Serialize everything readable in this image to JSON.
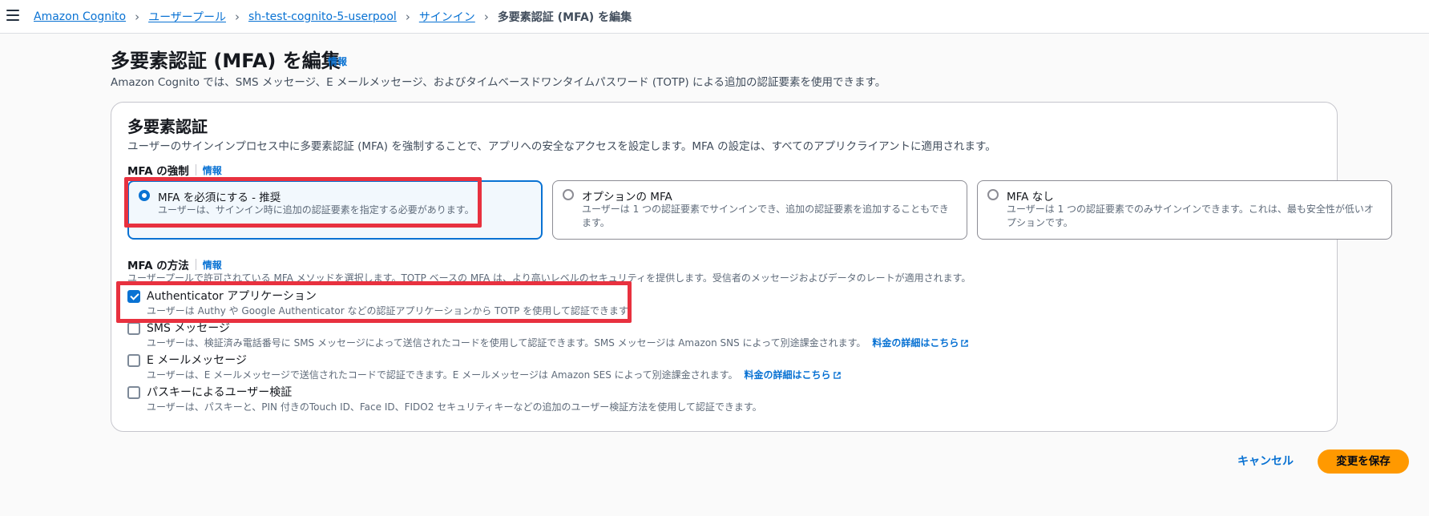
{
  "breadcrumb": {
    "items": [
      "Amazon Cognito",
      "ユーザープール",
      "sh-test-cognito-5-userpool",
      "サインイン"
    ],
    "current": "多要素認証 (MFA) を編集"
  },
  "page": {
    "title": "多要素認証 (MFA) を編集",
    "info": "情報",
    "description": "Amazon Cognito では、SMS メッセージ、E メールメッセージ、およびタイムベースドワンタイムパスワード (TOTP) による追加の認証要素を使用できます。"
  },
  "panel": {
    "title": "多要素認証",
    "description": "ユーザーのサインインプロセス中に多要素認証 (MFA) を強制することで、アプリへの安全なアクセスを設定します。MFA の設定は、すべてのアプリクライアントに適用されます。"
  },
  "enforcement": {
    "label": "MFA の強制",
    "info": "情報",
    "options": [
      {
        "title": "MFA を必須にする - 推奨",
        "desc": "ユーザーは、サインイン時に追加の認証要素を指定する必要があります。",
        "selected": true
      },
      {
        "title": "オプションの MFA",
        "desc": "ユーザーは 1 つの認証要素でサインインでき、追加の認証要素を追加することもできます。",
        "selected": false
      },
      {
        "title": "MFA なし",
        "desc": "ユーザーは 1 つの認証要素でのみサインインできます。これは、最も安全性が低いオプションです。",
        "selected": false
      }
    ]
  },
  "methods": {
    "label": "MFA の方法",
    "info": "情報",
    "description": "ユーザープールで許可されている MFA メソッドを選択します。TOTP ベースの MFA は、より高いレベルのセキュリティを提供します。受信者のメッセージおよびデータのレートが適用されます。",
    "items": [
      {
        "title": "Authenticator アプリケーション",
        "desc": "ユーザーは Authy や Google Authenticator などの認証アプリケーションから TOTP を使用して認証できます。",
        "checked": true,
        "link": ""
      },
      {
        "title": "SMS メッセージ",
        "desc": "ユーザーは、検証済み電話番号に SMS メッセージによって送信されたコードを使用して認証できます。SMS メッセージは Amazon SNS によって別途課金されます。",
        "checked": false,
        "link": "料金の詳細はこちら"
      },
      {
        "title": "E メールメッセージ",
        "desc": "ユーザーは、E メールメッセージで送信されたコードで認証できます。E メールメッセージは Amazon SES によって別途課金されます。",
        "checked": false,
        "link": "料金の詳細はこちら"
      },
      {
        "title": "パスキーによるユーザー検証",
        "desc": "ユーザーは、パスキーと、PIN 付きのTouch ID、Face ID、FIDO2 セキュリティキーなどの追加のユーザー検証方法を使用して認証できます。",
        "checked": false,
        "link": ""
      }
    ]
  },
  "actions": {
    "cancel": "キャンセル",
    "save": "変更を保存"
  },
  "colors": {
    "link": "#0972d3",
    "primary": "#ff9900",
    "highlight": "#e8313f"
  }
}
